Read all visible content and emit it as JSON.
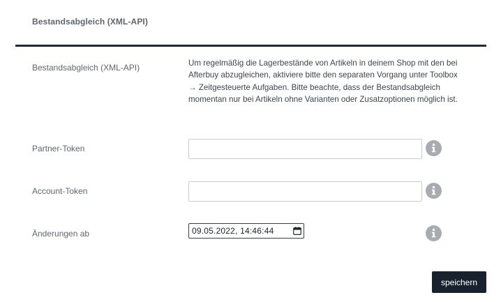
{
  "section": {
    "title": "Bestandsabgleich (XML-API)"
  },
  "fields": {
    "sync": {
      "label": "Bestandsabgleich (XML-API)",
      "description": "Um regelmäßig die Lagerbestände von Artikeln in deinem Shop mit den bei Afterbuy abzugleichen, aktiviere bitte den separaten Vorgang unter Toolbox → Zeitgesteuerte Aufgaben. Bitte beachte, dass der Bestandsabgleich momentan nur bei Artikeln ohne Varianten oder Zusatzoptionen möglich ist."
    },
    "partner_token": {
      "label": "Partner-Token",
      "value": "",
      "help_icon": "info-icon"
    },
    "account_token": {
      "label": "Account-Token",
      "value": "",
      "help_icon": "info-icon"
    },
    "changes_since": {
      "label": "Änderungen ab",
      "value": "09.05.2022, 14:46:44",
      "picker_icon": "calendar-icon",
      "help_icon": "info-icon"
    }
  },
  "actions": {
    "save_label": "speichern"
  },
  "colors": {
    "rule": "#1d2a38",
    "button_bg": "#17222e",
    "info_icon": "#a8acb0"
  }
}
